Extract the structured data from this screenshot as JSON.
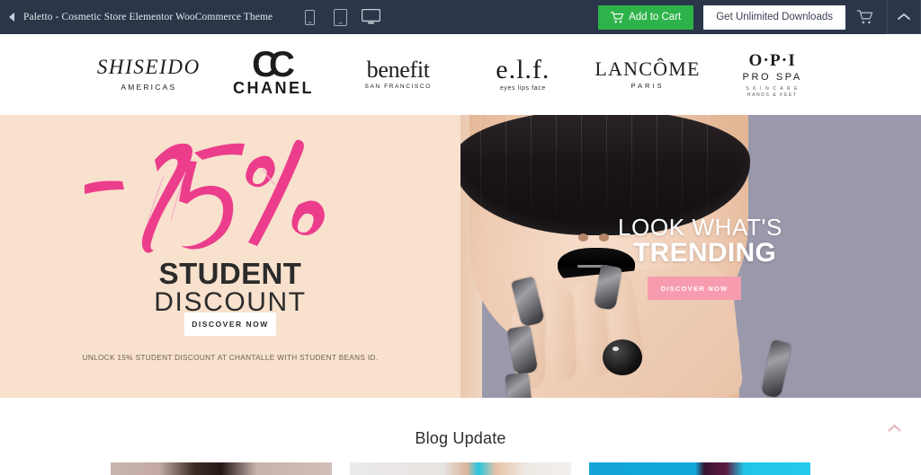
{
  "preview_bar": {
    "back_icon": "caret-left-icon",
    "title": "Paletto - Cosmetic Store Elementor WooCommerce Theme",
    "devices": [
      {
        "name": "mobile",
        "icon": "mobile-icon"
      },
      {
        "name": "tablet",
        "icon": "tablet-icon"
      },
      {
        "name": "desktop",
        "icon": "desktop-icon"
      }
    ],
    "add_to_cart_label": "Add to Cart",
    "add_to_cart_icon": "cart-icon",
    "add_to_cart_color": "#2eb34a",
    "get_unlimited_label": "Get Unlimited Downloads",
    "cart_icon": "cart-icon",
    "collapse_icon": "chevron-up-icon",
    "background_color": "#2b3648"
  },
  "brands": [
    {
      "name": "shiseido",
      "main": "SHISEIDO",
      "sub": "AMERICAS"
    },
    {
      "name": "chanel",
      "main": "CC",
      "sub": "CHANEL"
    },
    {
      "name": "benefit",
      "main": "benefit",
      "sub": "SAN FRANCISCO"
    },
    {
      "name": "elf",
      "main": "e.l.f.",
      "sub": "eyes lips face"
    },
    {
      "name": "lancome",
      "main": "LANCÔME",
      "sub": "PARIS"
    },
    {
      "name": "opi",
      "main": "O·P·I",
      "sub": "PRO SPA",
      "sub2": "S K I N C A R E",
      "sub3": "HANDS & FEET"
    }
  ],
  "hero": {
    "left": {
      "background_color": "#f8e1cd",
      "discount_text": "-15%",
      "discount_color": "#ec3d8c",
      "headline_bold": "STUDENT",
      "headline_light": "DISCOUNT",
      "button_label": "DISCOVER NOW",
      "disclaimer": "UNLOCK 15% STUDENT DISCOUNT AT CHANTALLE WITH STUDENT BEANS ID."
    },
    "right": {
      "background_color": "#9a99ac",
      "headline_light": "LOOK WHAT'S",
      "headline_bold": "TRENDING",
      "button_label": "DISCOVER NOW",
      "button_color": "#f79bae"
    }
  },
  "blog": {
    "title": "Blog Update",
    "cards": [
      {
        "name": "blog-card-1"
      },
      {
        "name": "blog-card-2"
      },
      {
        "name": "blog-card-3"
      }
    ]
  },
  "scroll_top": {
    "icon": "chevron-up-icon",
    "color": "#e2b6bd"
  }
}
